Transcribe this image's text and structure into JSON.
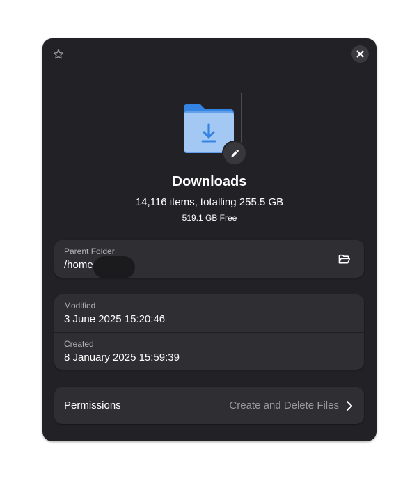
{
  "header": {
    "star_icon": "star-icon",
    "close_icon": "close-icon"
  },
  "file": {
    "icon": "folder-download-icon",
    "name": "Downloads",
    "summary": "14,116 items, totalling 255.5 GB",
    "free_space": "519.1 GB Free"
  },
  "location": {
    "label": "Parent Folder",
    "value": "/home",
    "open_icon": "open-folder-icon"
  },
  "dates": {
    "modified_label": "Modified",
    "modified_value": "3 June 2025 15:20:46",
    "created_label": "Created",
    "created_value": "8 January 2025 15:59:39"
  },
  "permissions": {
    "label": "Permissions",
    "value": "Create and Delete Files"
  },
  "colors": {
    "dialog_bg": "#222226",
    "card_bg": "#2f2f33",
    "folder_blue": "#62a0ea",
    "folder_light": "#a4c8f4",
    "arrow_blue": "#3584e4"
  }
}
